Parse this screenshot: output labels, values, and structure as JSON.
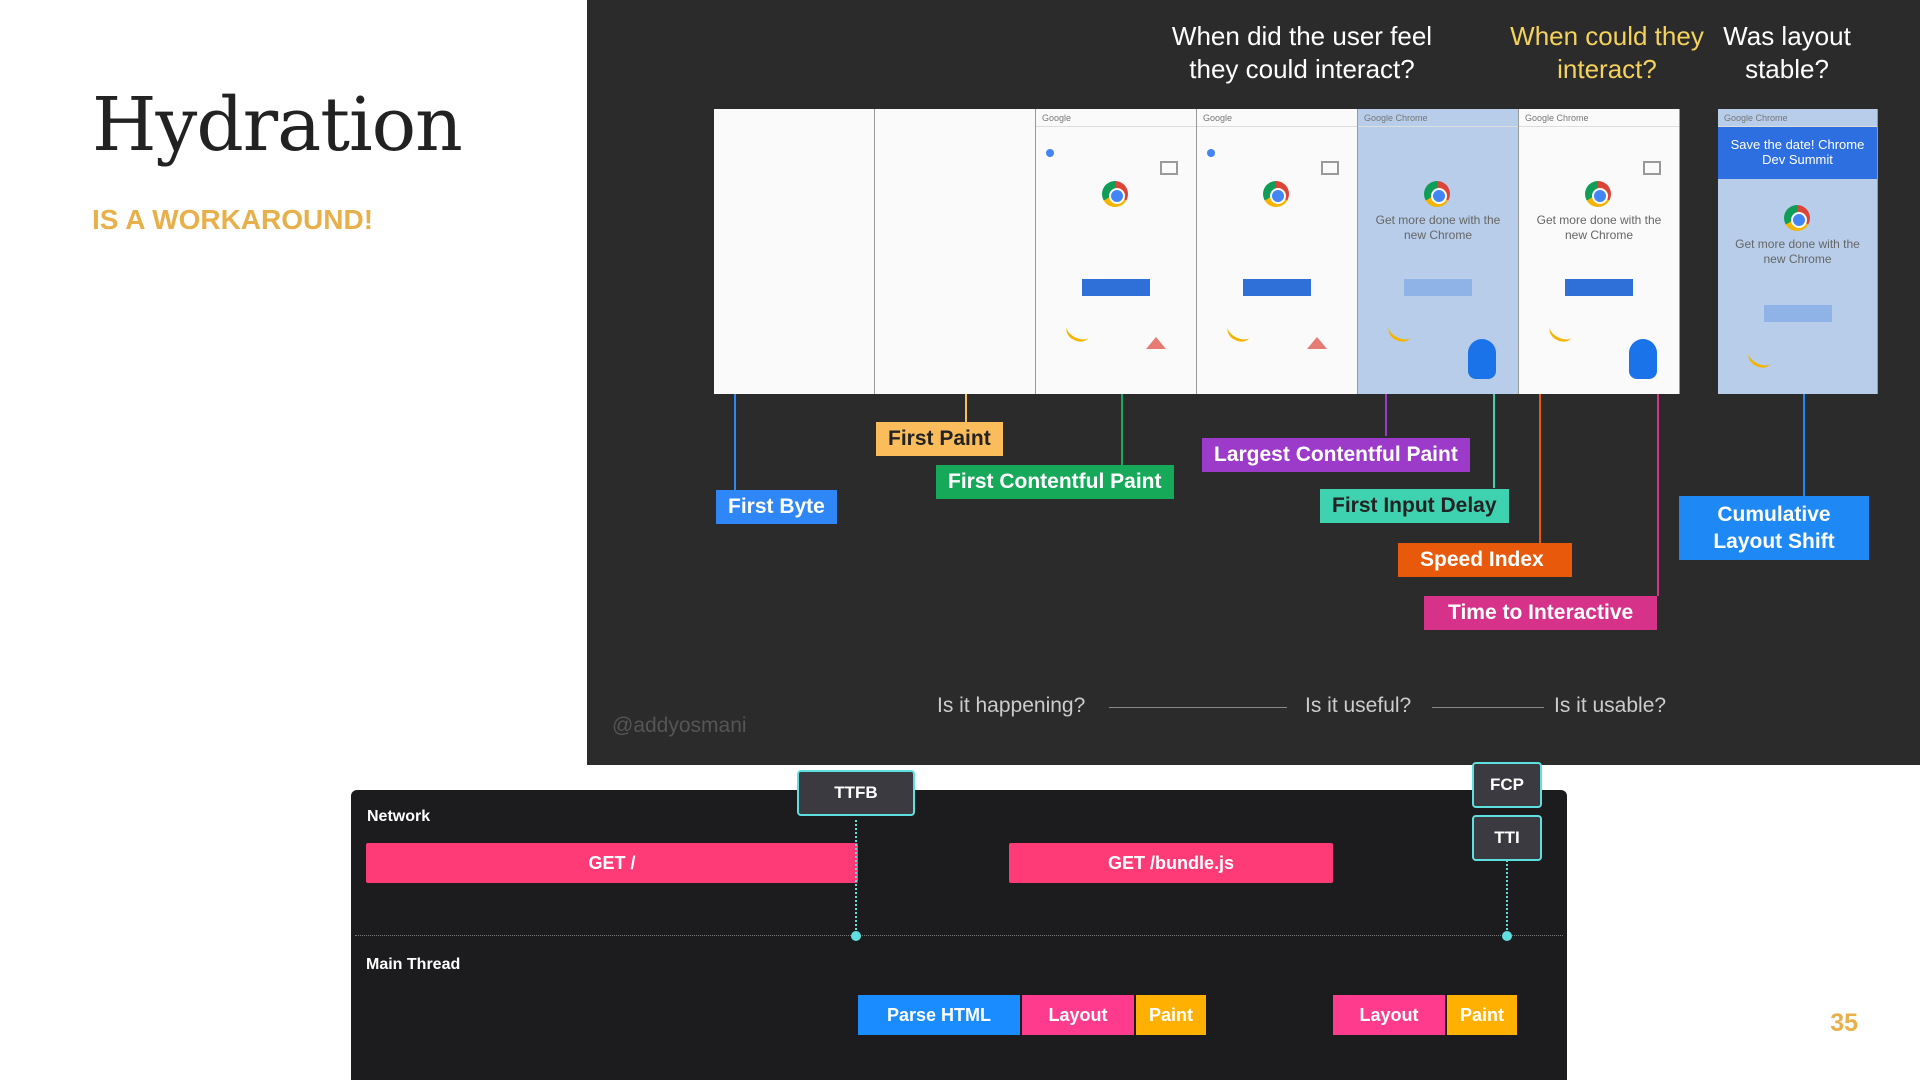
{
  "slide": {
    "title": "Hydration",
    "subtitle": "IS A WORKAROUND!",
    "page_number": "35"
  },
  "metrics_image": {
    "questions": [
      {
        "text": "When did the user feel they could interact?",
        "color": "#ffffff"
      },
      {
        "text": "When could they interact?",
        "color": "#f5d25b"
      },
      {
        "text": "Was layout stable?",
        "color": "#ffffff"
      }
    ],
    "frames": [
      {
        "bar": "",
        "body": "",
        "button": false
      },
      {
        "bar": "",
        "body": "",
        "button": false
      },
      {
        "bar": "Google",
        "body": "",
        "button": true
      },
      {
        "bar": "Google",
        "body": "",
        "button": true
      },
      {
        "bar": "Google Chrome",
        "body": "Get more done with the new Chrome",
        "button": true
      },
      {
        "bar": "Google Chrome",
        "body": "Get more done with the new Chrome",
        "button": true
      },
      {
        "bar": "Google Chrome",
        "banner": "Save the date! Chrome Dev Summit",
        "body": "Get more done with the new Chrome",
        "button": true
      }
    ],
    "metric_labels": [
      {
        "text": "First Byte",
        "color": "#2f86f6"
      },
      {
        "text": "First Paint",
        "color": "#fbbd5b"
      },
      {
        "text": "First Contentful Paint",
        "color": "#16a95a"
      },
      {
        "text": "Largest Contentful Paint",
        "color": "#9c3ac9"
      },
      {
        "text": "First Input Delay",
        "color": "#3fd2b0"
      },
      {
        "text": "Speed Index",
        "color": "#e8590c"
      },
      {
        "text": "Time to Interactive",
        "color": "#d6328a"
      },
      {
        "text": "Cumulative Layout Shift",
        "color": "#1e88f5"
      }
    ],
    "stages": [
      "Is it happening?",
      "Is it useful?",
      "Is it usable?"
    ],
    "watermark": "@addyosmani"
  },
  "timeline": {
    "network_label": "Network",
    "main_thread_label": "Main Thread",
    "network_bars": [
      "GET /",
      "GET /bundle.js"
    ],
    "main_thread_bars": [
      {
        "label": "Parse HTML",
        "color": "#1a8cff"
      },
      {
        "label": "Layout",
        "color": "#ff3b8d"
      },
      {
        "label": "Paint",
        "color": "#ffb000"
      },
      {
        "label": "Layout",
        "color": "#ff3b8d"
      },
      {
        "label": "Paint",
        "color": "#ffb000"
      }
    ],
    "markers": [
      "TTFB",
      "FCP",
      "TTI"
    ],
    "accent": "#5fe0e0"
  }
}
